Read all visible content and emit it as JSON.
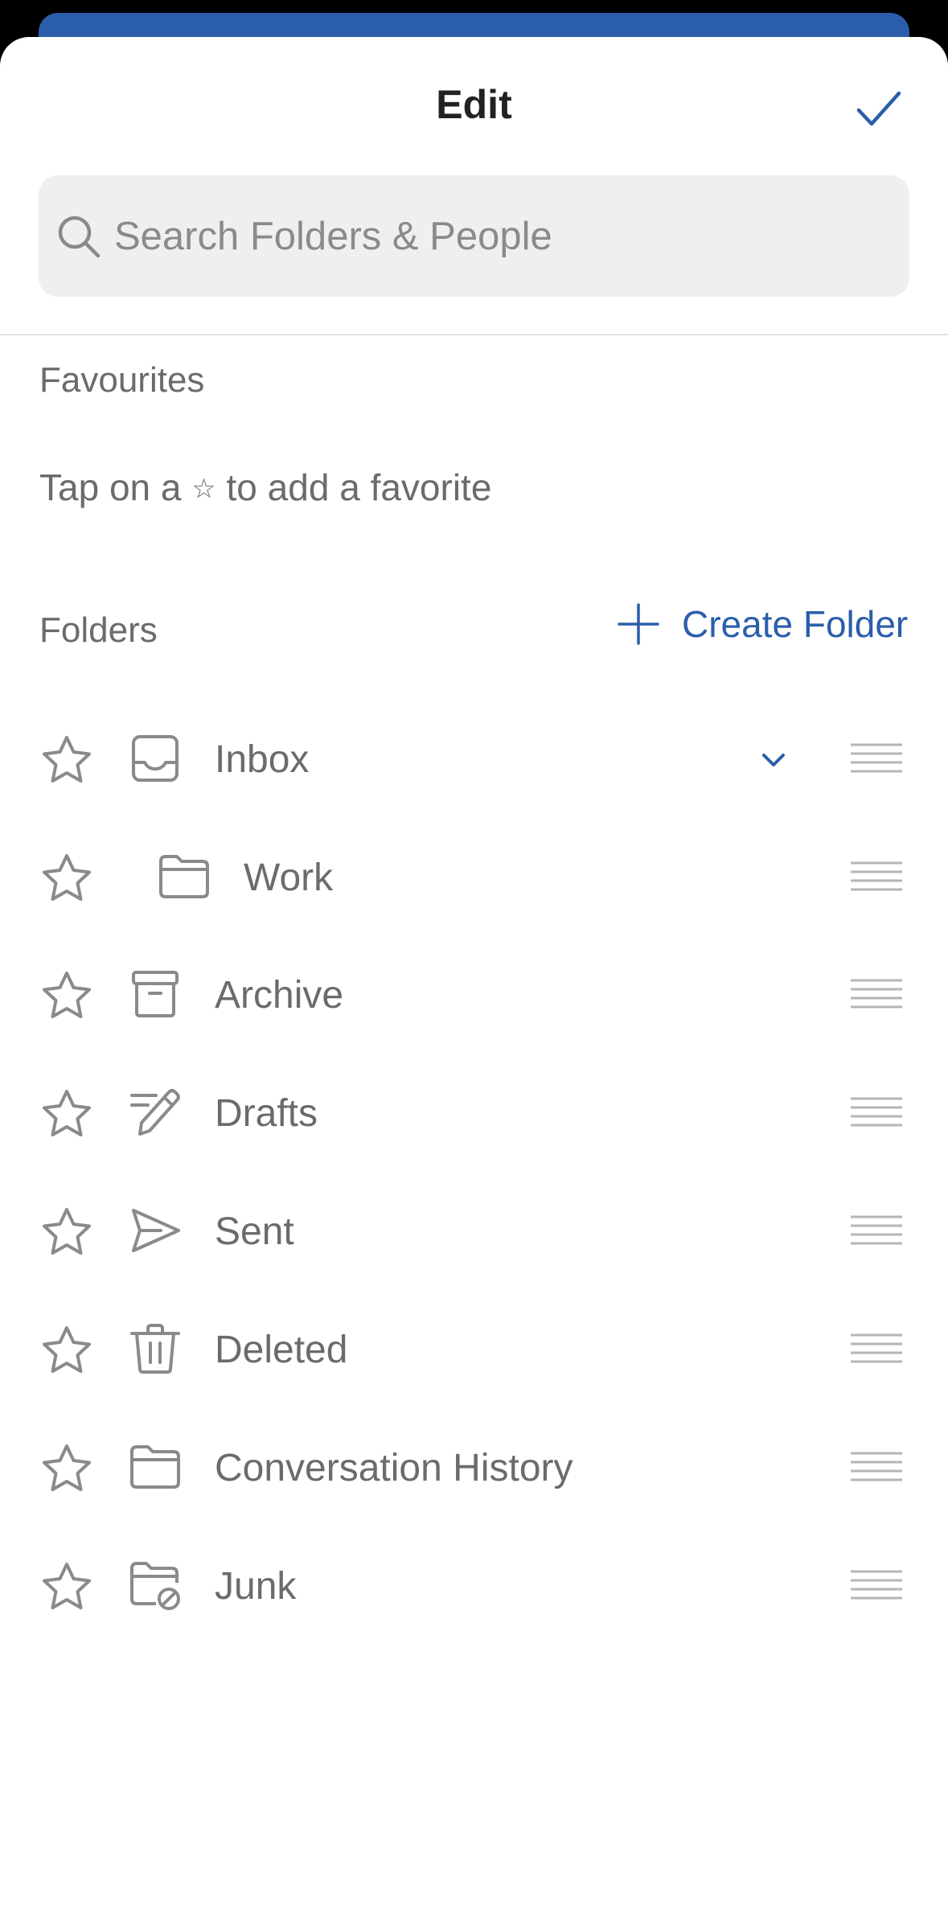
{
  "header": {
    "title": "Edit"
  },
  "search": {
    "placeholder": "Search Folders & People"
  },
  "favourites": {
    "title": "Favourites",
    "hint_before": "Tap on a",
    "hint_star": "☆",
    "hint_after": "to add a favorite"
  },
  "folders": {
    "title": "Folders",
    "create_label": "Create Folder",
    "items": [
      {
        "label": "Inbox",
        "icon": "inbox-icon"
      },
      {
        "label": "Work",
        "icon": "folder-icon"
      },
      {
        "label": "Archive",
        "icon": "archive-icon"
      },
      {
        "label": "Drafts",
        "icon": "drafts-icon"
      },
      {
        "label": "Sent",
        "icon": "send-icon"
      },
      {
        "label": "Deleted",
        "icon": "trash-icon"
      },
      {
        "label": "Conversation History",
        "icon": "folder-icon"
      },
      {
        "label": "Junk",
        "icon": "junk-folder-icon"
      }
    ]
  },
  "colors": {
    "accent": "#2b5eaa",
    "text_secondary": "#6b6b6b",
    "icon_gray": "#8a8a8a"
  }
}
